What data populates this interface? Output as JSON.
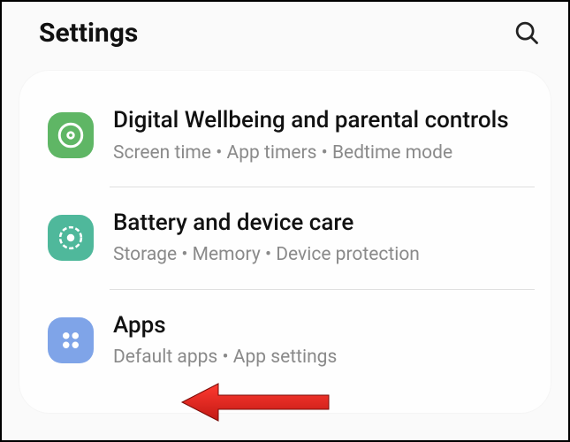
{
  "header": {
    "title": "Settings"
  },
  "items": [
    {
      "title": "Digital Wellbeing and parental controls",
      "subtitle": "Screen time  •  App timers  •  Bedtime mode"
    },
    {
      "title": "Battery and device care",
      "subtitle": "Storage  •  Memory  •  Device protection"
    },
    {
      "title": "Apps",
      "subtitle": "Default apps  •  App settings"
    }
  ]
}
